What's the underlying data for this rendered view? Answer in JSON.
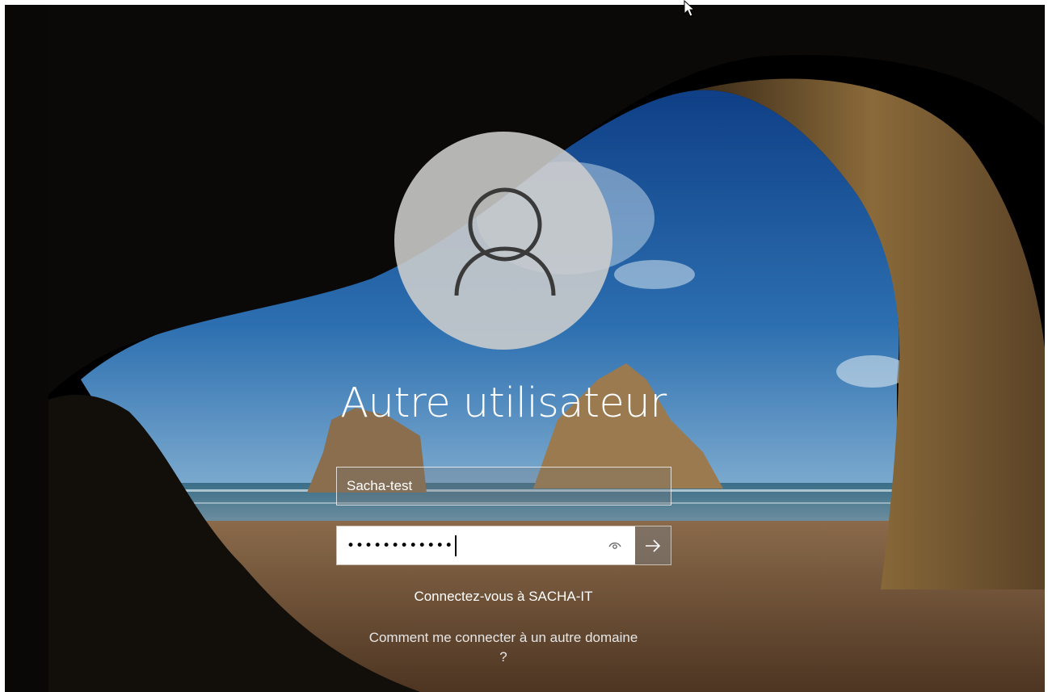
{
  "login": {
    "user_title": "Autre utilisateur",
    "username_value": "Sacha-test",
    "password_dots": "••••••••••••",
    "sign_in_to": "Connectez-vous à SACHA-IT",
    "other_domain_link": "Comment me connecter à un autre domaine ?"
  },
  "icons": {
    "avatar": "user-silhouette-icon",
    "reveal": "eye-icon",
    "submit": "arrow-right-icon",
    "cursor": "mouse-pointer-icon"
  },
  "colors": {
    "avatar_bg": "#cdcdcd",
    "field_border": "#ffffff",
    "submit_bg": "#787878"
  }
}
